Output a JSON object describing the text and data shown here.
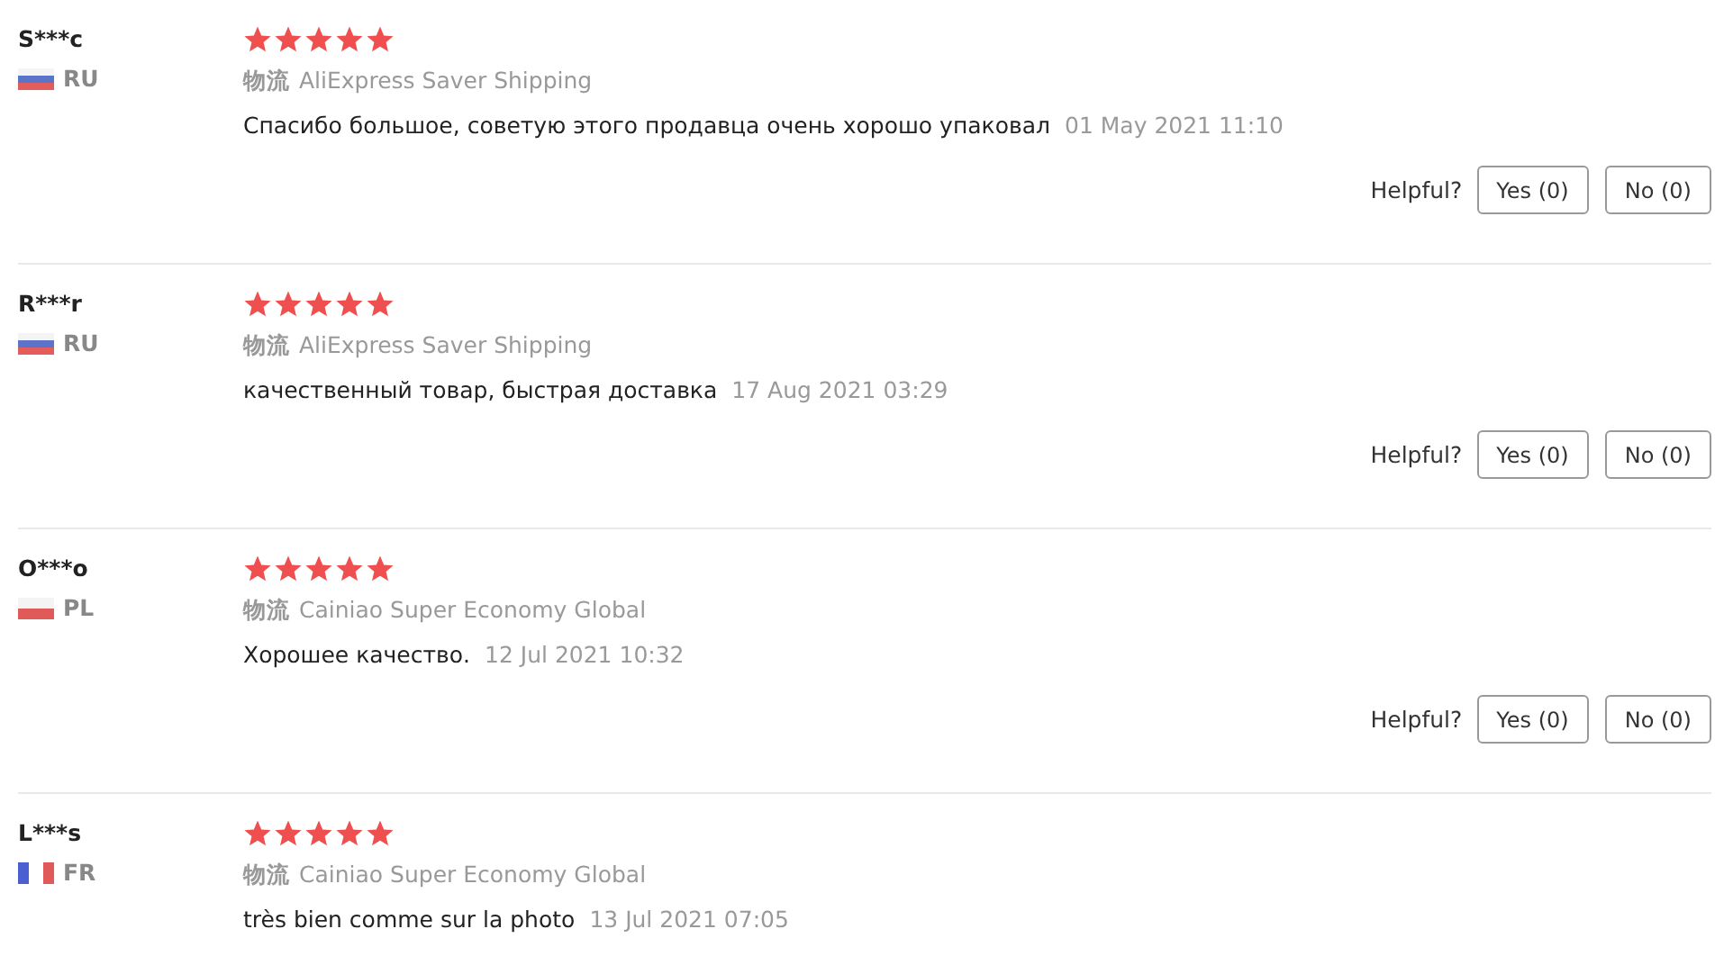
{
  "reviews": [
    {
      "user": "S***c",
      "kind": "ru",
      "country": "RU",
      "stars": 5,
      "shipping_label": "物流",
      "shipping": "AliExpress Saver Shipping",
      "comment": "Спасибо большое, советую этого продавца очень хорошо упаковал",
      "date": "01 May 2021 11:10",
      "helpful_label": "Helpful?",
      "yes": "Yes (0)",
      "no": "No (0)"
    },
    {
      "user": "R***r",
      "kind": "ru",
      "country": "RU",
      "stars": 5,
      "shipping_label": "物流",
      "shipping": "AliExpress Saver Shipping",
      "comment": "качественный товар, быстрая доставка",
      "date": "17 Aug 2021 03:29",
      "helpful_label": "Helpful?",
      "yes": "Yes (0)",
      "no": "No (0)"
    },
    {
      "user": "O***o",
      "kind": "pl",
      "country": "PL",
      "stars": 5,
      "shipping_label": "物流",
      "shipping": "Cainiao Super Economy Global",
      "comment": "Хорошее качество.",
      "date": "12 Jul 2021 10:32",
      "helpful_label": "Helpful?",
      "yes": "Yes (0)",
      "no": "No (0)"
    },
    {
      "user": "L***s",
      "kind": "fr",
      "country": "FR",
      "stars": 5,
      "shipping_label": "物流",
      "shipping": "Cainiao Super Economy Global",
      "comment": "très bien comme sur la photo",
      "date": "13 Jul 2021 07:05"
    }
  ]
}
